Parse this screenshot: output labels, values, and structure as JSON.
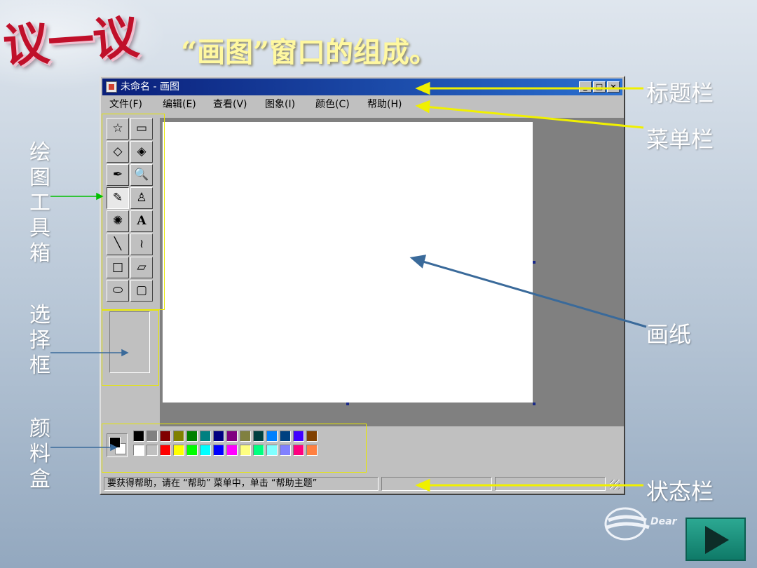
{
  "banner": "议一议",
  "slide_title": "“画图”窗口的组成。",
  "window": {
    "title": "未命名 - 画图",
    "menu": [
      "文件(F)",
      "编辑(E)",
      "查看(V)",
      "图象(I)",
      "颜色(C)",
      "帮助(H)"
    ],
    "tools": [
      "free-select",
      "rect-select",
      "eraser",
      "fill",
      "color-picker",
      "magnifier",
      "pencil",
      "brush",
      "airbrush",
      "text",
      "line",
      "curve",
      "rectangle",
      "polygon",
      "ellipse",
      "rounded-rect"
    ],
    "tool_glyphs": [
      "☆",
      "▭",
      "◇",
      "◈",
      "✒",
      "🔍",
      "✎",
      "♙",
      "✺",
      "A",
      "╲",
      "≀",
      "□",
      "▱",
      "⬭",
      "▢"
    ],
    "palette_top": [
      "#000000",
      "#808080",
      "#800000",
      "#808000",
      "#008000",
      "#008080",
      "#000080",
      "#800080",
      "#808040",
      "#004040",
      "#0080ff",
      "#004080",
      "#4000ff",
      "#804000"
    ],
    "palette_bottom": [
      "#ffffff",
      "#c0c0c0",
      "#ff0000",
      "#ffff00",
      "#00ff00",
      "#00ffff",
      "#0000ff",
      "#ff00ff",
      "#ffff80",
      "#00ff80",
      "#80ffff",
      "#8080ff",
      "#ff0080",
      "#ff8040"
    ],
    "status_text": "要获得帮助，请在 “帮助” 菜单中，单击 “帮助主题”"
  },
  "annotations": {
    "title_bar": "标题栏",
    "menu_bar": "菜单栏",
    "canvas": "画纸",
    "status_bar": "状态栏",
    "toolbox": "绘图工具箱",
    "option_box": "选择框",
    "color_box": "颜料盒"
  },
  "logo_text": "Dear",
  "colors": {
    "annotation_arrow": "#f0f000",
    "toolbox_arrow": "#00c000",
    "canvas_arrow": "#3a6a9a"
  }
}
